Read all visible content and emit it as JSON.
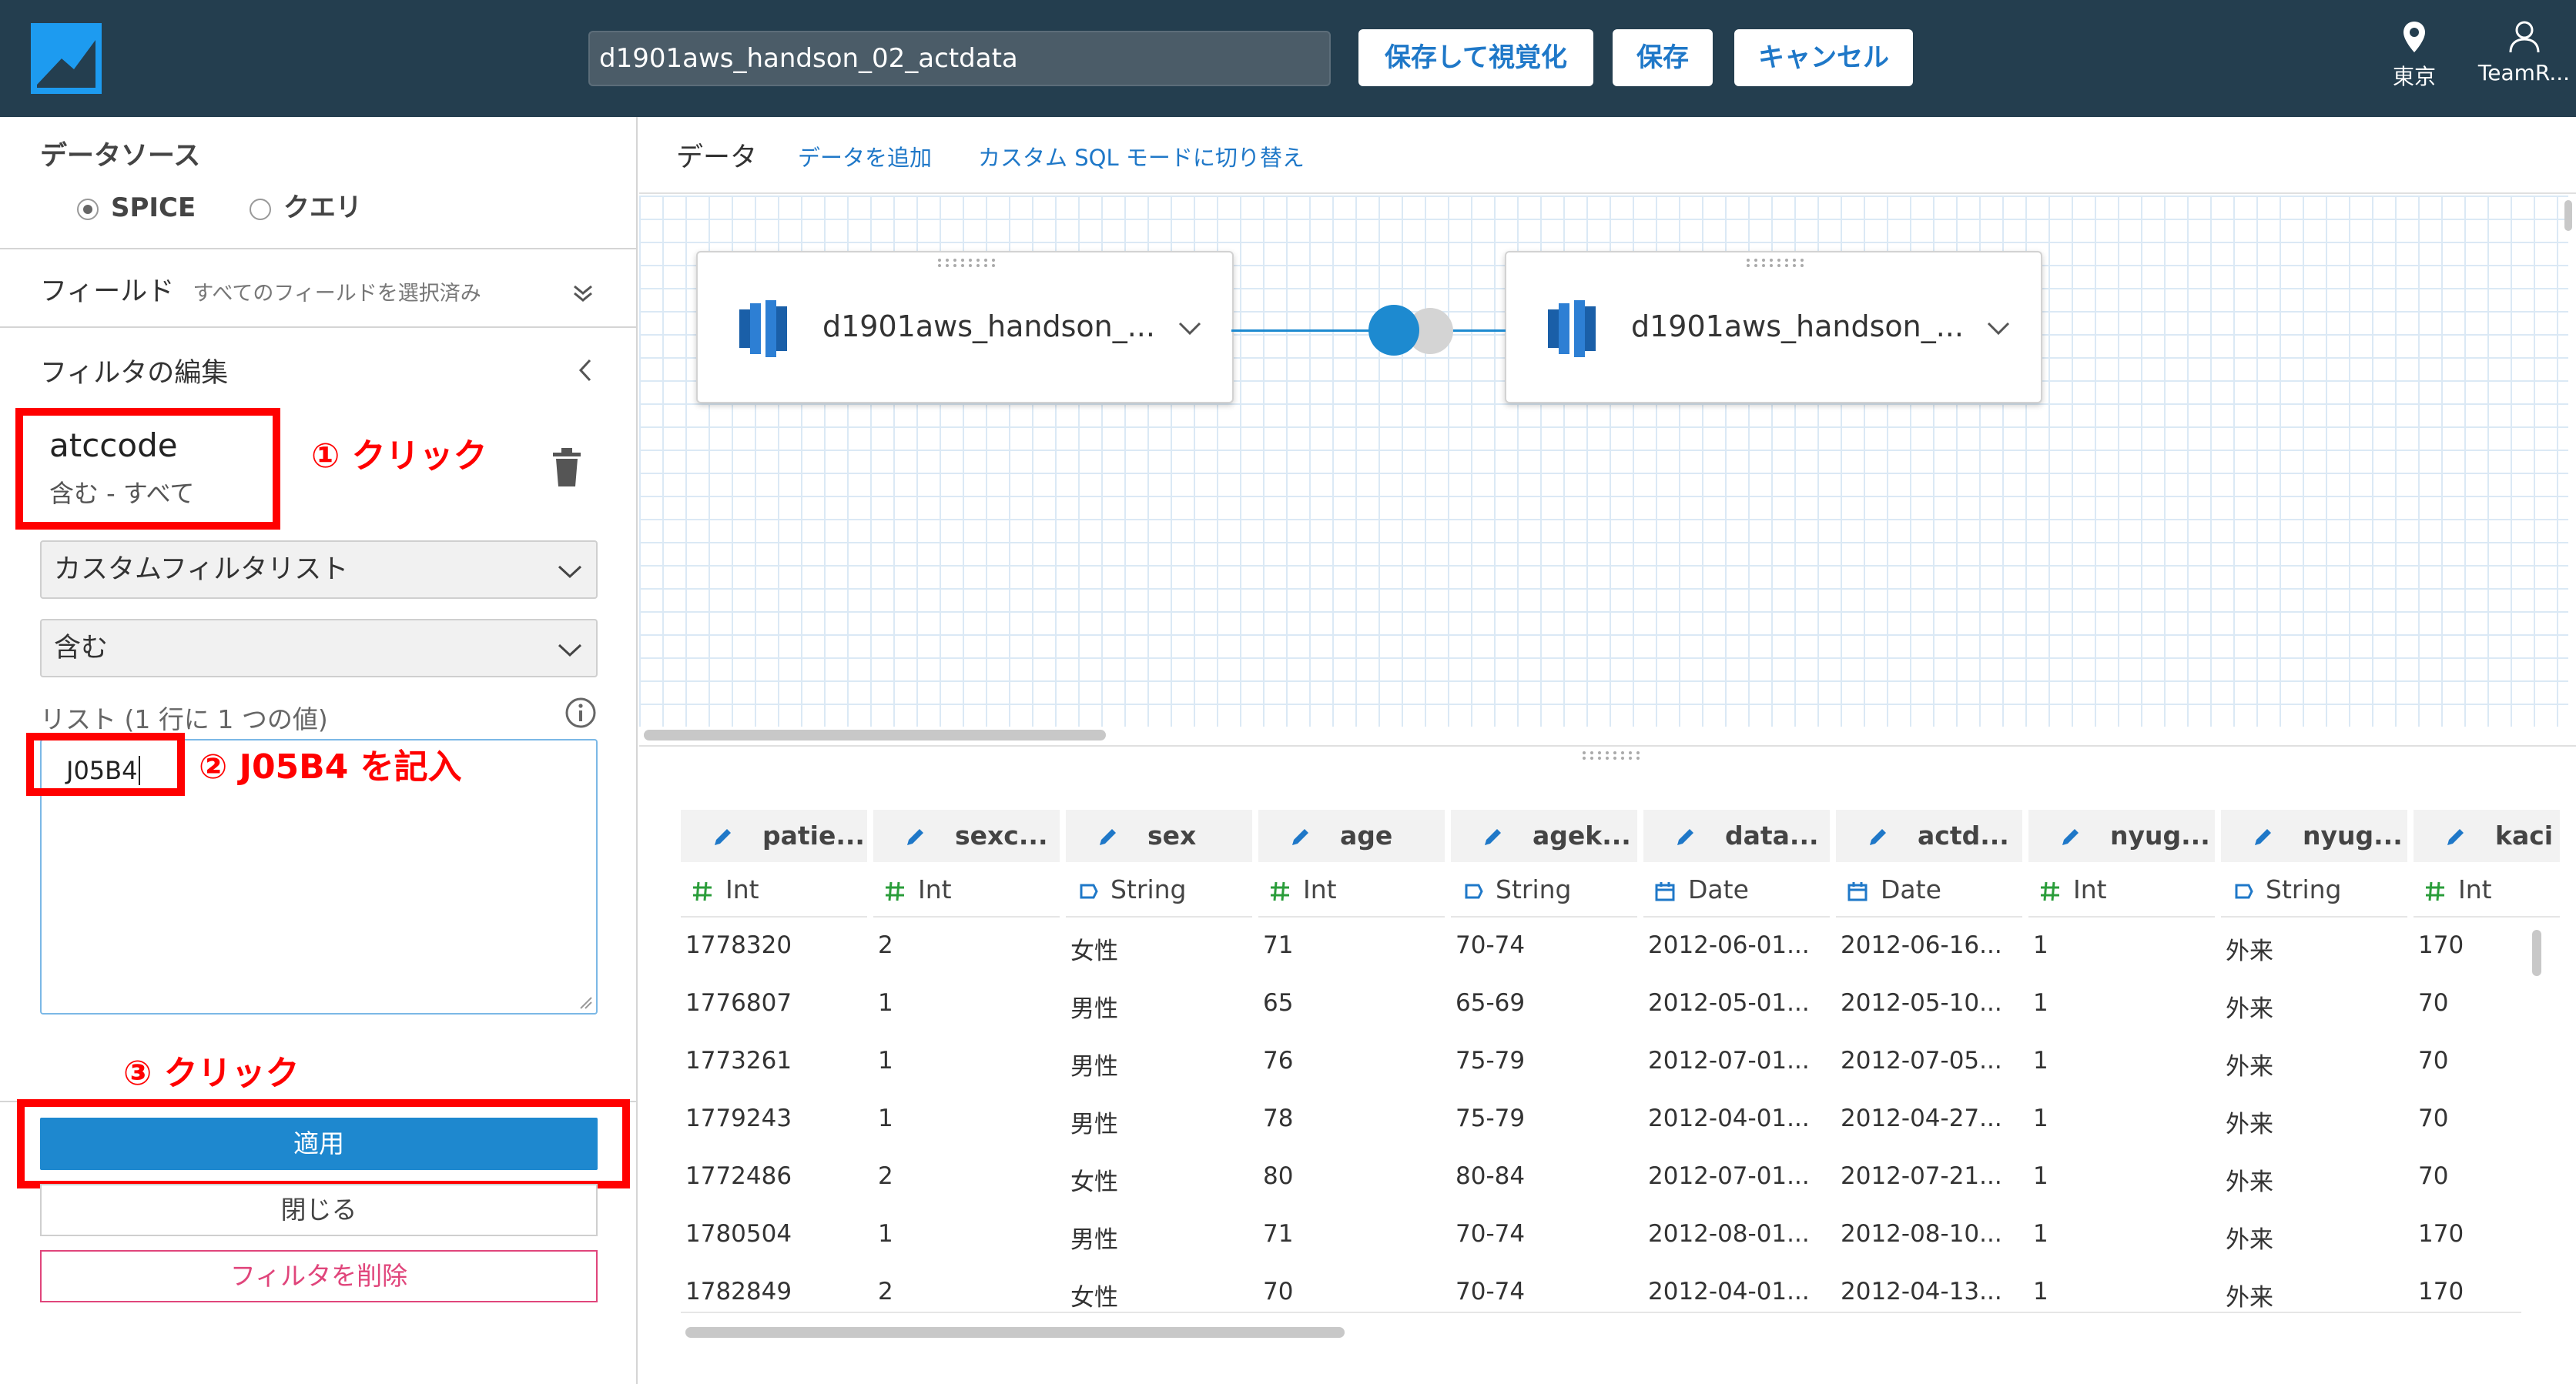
{
  "header": {
    "dataset_name": "d1901aws_handson_02_actdata",
    "save_visualize_label": "保存して視覚化",
    "save_label": "保存",
    "cancel_label": "キャンセル",
    "region_label": "東京",
    "user_label": "TeamR..."
  },
  "left_panel": {
    "datasource_title": "データソース",
    "spice_label": "SPICE",
    "query_label": "クエリ",
    "spice_selected": true,
    "fields_title": "フィールド",
    "fields_status": "すべてのフィールドを選択済み",
    "filter_edit_title": "フィルタの編集",
    "filter_name": "atccode",
    "filter_summary": "含む - すべて",
    "filter_type_value": "カスタムフィルタリスト",
    "match_value": "含む",
    "list_label": "リスト (1 行に 1 つの値)",
    "list_value": "J05B4",
    "apply_label": "適用",
    "close_label": "閉じる",
    "delete_label": "フィルタを削除"
  },
  "annotations": {
    "step1": "① クリック",
    "step2": "② J05B4 を記入",
    "step3": "③ クリック",
    "highlight_color": "#ff0000"
  },
  "main": {
    "data_label": "データ",
    "add_data_label": "データを追加",
    "custom_sql_label": "カスタム SQL モードに切り替え",
    "source_cards": [
      {
        "name": "d1901aws_handson_..."
      },
      {
        "name": "d1901aws_handson_..."
      }
    ]
  },
  "table": {
    "columns": [
      {
        "name": "patie...",
        "type": "Int",
        "type_icon": "hash-icon"
      },
      {
        "name": "sexc...",
        "type": "Int",
        "type_icon": "hash-icon"
      },
      {
        "name": "sex",
        "type": "String",
        "type_icon": "tag-icon"
      },
      {
        "name": "age",
        "type": "Int",
        "type_icon": "hash-icon"
      },
      {
        "name": "agek...",
        "type": "String",
        "type_icon": "tag-icon"
      },
      {
        "name": "data...",
        "type": "Date",
        "type_icon": "calendar-icon"
      },
      {
        "name": "actd...",
        "type": "Date",
        "type_icon": "calendar-icon"
      },
      {
        "name": "nyug...",
        "type": "Int",
        "type_icon": "hash-icon"
      },
      {
        "name": "nyug...",
        "type": "String",
        "type_icon": "tag-icon"
      },
      {
        "name": "kaci",
        "type": "Int",
        "type_icon": "hash-icon"
      }
    ],
    "rows": [
      [
        "1778320",
        "2",
        "女性",
        "71",
        "70-74",
        "2012-06-01...",
        "2012-06-16...",
        "1",
        "外来",
        "170"
      ],
      [
        "1776807",
        "1",
        "男性",
        "65",
        "65-69",
        "2012-05-01...",
        "2012-05-10...",
        "1",
        "外来",
        "70"
      ],
      [
        "1773261",
        "1",
        "男性",
        "76",
        "75-79",
        "2012-07-01...",
        "2012-07-05...",
        "1",
        "外来",
        "70"
      ],
      [
        "1779243",
        "1",
        "男性",
        "78",
        "75-79",
        "2012-04-01...",
        "2012-04-27...",
        "1",
        "外来",
        "70"
      ],
      [
        "1772486",
        "2",
        "女性",
        "80",
        "80-84",
        "2012-07-01...",
        "2012-07-21...",
        "1",
        "外来",
        "70"
      ],
      [
        "1780504",
        "1",
        "男性",
        "71",
        "70-74",
        "2012-08-01...",
        "2012-08-10...",
        "1",
        "外来",
        "170"
      ],
      [
        "1782849",
        "2",
        "女性",
        "70",
        "70-74",
        "2012-04-01...",
        "2012-04-13...",
        "1",
        "外来",
        "170"
      ]
    ]
  }
}
